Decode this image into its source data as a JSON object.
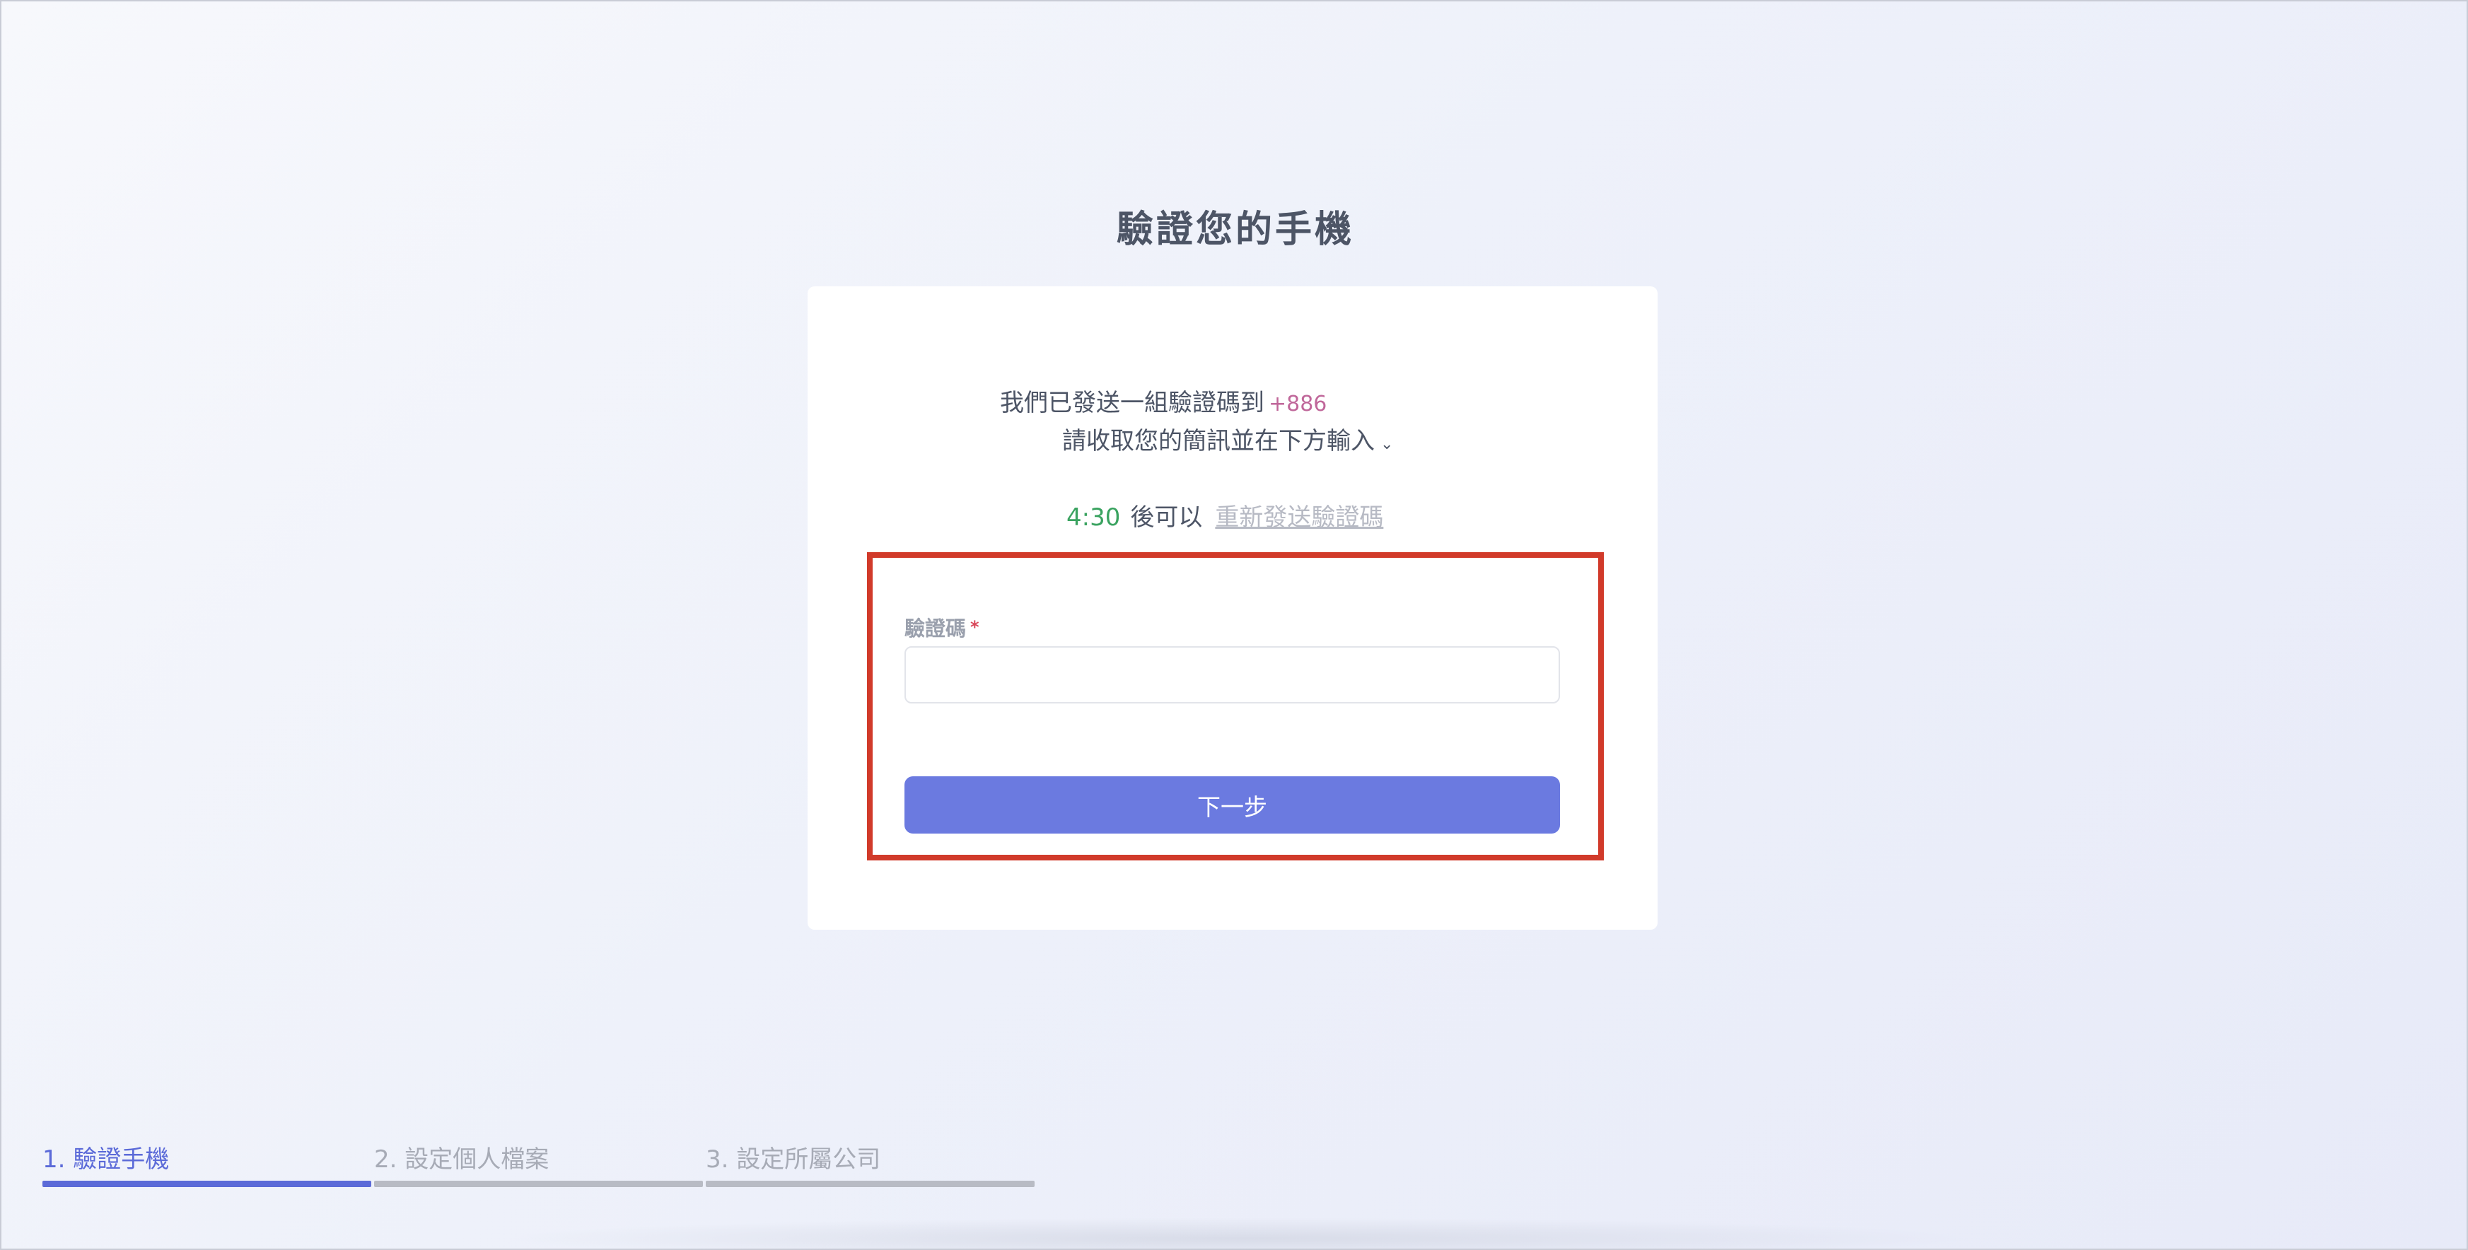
{
  "page": {
    "title": "驗證您的手機"
  },
  "message": {
    "line1": "我們已發送一組驗證碼到",
    "phone": "+886",
    "line2": "請收取您的簡訊並在下方輸入"
  },
  "resend": {
    "timer": "4:30",
    "after_text": "後可以",
    "link_label": "重新發送驗證碼"
  },
  "form": {
    "code_label": "驗證碼",
    "required_mark": "*",
    "code_value": "",
    "next_label": "下一步"
  },
  "steps": [
    {
      "label": "1. 驗證手機",
      "state": "active"
    },
    {
      "label": "2. 設定個人檔案",
      "state": "inactive"
    },
    {
      "label": "3. 設定所屬公司",
      "state": "inactive"
    }
  ],
  "colors": {
    "accent": "#6b7ae0",
    "timer": "#3aa360",
    "phone": "#c0679a",
    "highlight": "#d13a2a"
  }
}
